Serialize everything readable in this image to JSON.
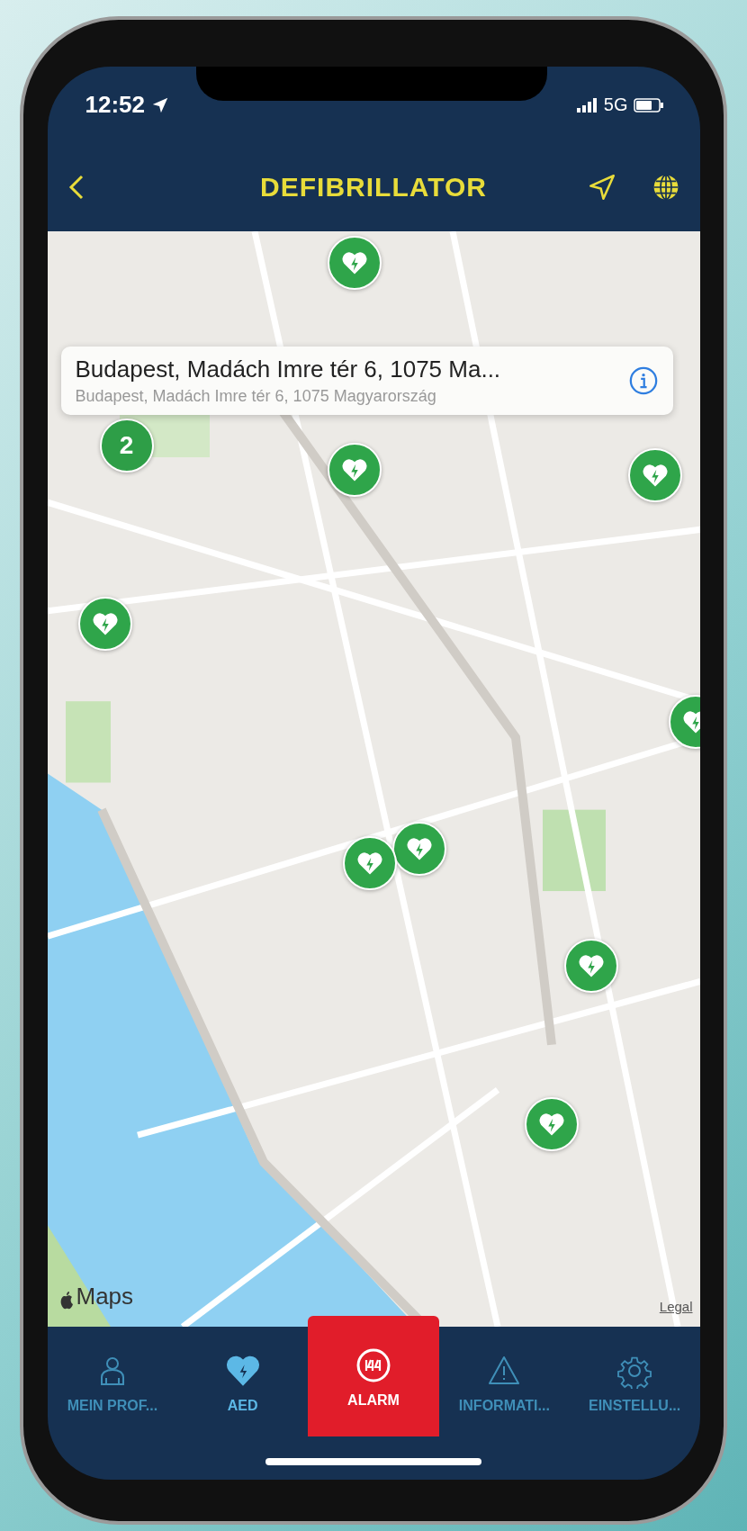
{
  "status_bar": {
    "time": "12:52",
    "network": "5G"
  },
  "nav": {
    "title": "DEFIBRILLATOR"
  },
  "map": {
    "markers": [
      {
        "kind": "aed"
      },
      {
        "kind": "aed"
      },
      {
        "kind": "aed"
      },
      {
        "kind": "aed"
      },
      {
        "kind": "aed"
      },
      {
        "kind": "aed"
      },
      {
        "kind": "aed"
      },
      {
        "kind": "aed"
      },
      {
        "kind": "aed"
      },
      {
        "kind": "cluster",
        "label": "2"
      }
    ],
    "callout": {
      "title": "Budapest, Madách Imre tér 6, 1075 Ma...",
      "subtitle": "Budapest, Madách Imre tér 6, 1075 Magyarország"
    },
    "attribution": "Maps",
    "legal": "Legal"
  },
  "tabs": [
    {
      "label": "MEIN PROF...",
      "kind": "normal",
      "selected": false
    },
    {
      "label": "AED",
      "kind": "normal",
      "selected": true
    },
    {
      "label": "ALARM",
      "kind": "alarm",
      "selected": false
    },
    {
      "label": "INFORMATI...",
      "kind": "normal",
      "selected": false
    },
    {
      "label": "EINSTELLU...",
      "kind": "normal",
      "selected": false
    }
  ]
}
